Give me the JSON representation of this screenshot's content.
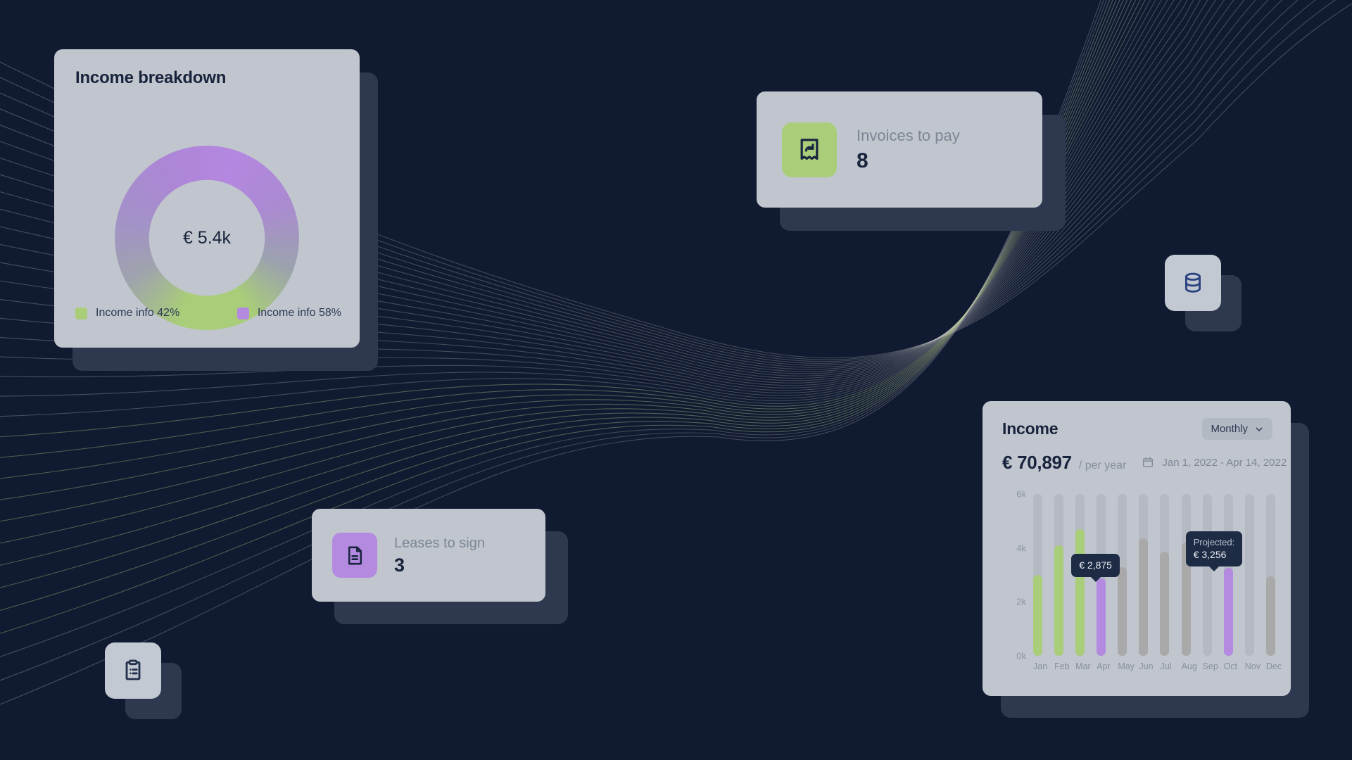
{
  "theme": {
    "background": "#101a31",
    "card_bg": "#c1c6ce",
    "shadow_card": "#2e3950",
    "green": "#a9cd78",
    "purple": "#b48ae0",
    "ink": "#18233c",
    "muted": "#7e8795",
    "tooltip_bg": "#1e2b45"
  },
  "income_breakdown": {
    "title": "Income breakdown",
    "center_value": "€ 5.4k",
    "legend": [
      {
        "label": "Income info 42%",
        "color": "#a9cd78"
      },
      {
        "label": "Income info 58%",
        "color": "#b48ae0"
      }
    ]
  },
  "invoices_card": {
    "icon": "invoice-forward-icon",
    "icon_bg": "#a9cd78",
    "label": "Invoices to pay",
    "value": "8"
  },
  "leases_card": {
    "icon": "document-lines-icon",
    "icon_bg": "#b48ae0",
    "label": "Leases to sign",
    "value": "3"
  },
  "tiles": [
    {
      "name": "database-icon",
      "color": "#2b4380"
    },
    {
      "name": "clipboard-list-icon",
      "color": "#22304c"
    }
  ],
  "income_chart": {
    "title": "Income",
    "period_label": "Monthly",
    "chevron": "chevron-down-icon",
    "amount": "€ 70,897",
    "amount_unit": "/ per year",
    "calendar_icon": "calendar-icon",
    "date_range": "Jan 1, 2022 - Apr 14, 2022"
  },
  "chart_data": {
    "type": "bar",
    "title": "Income",
    "xlabel": "",
    "ylabel": "",
    "ylim": [
      0,
      6000
    ],
    "ytick_labels": [
      "0k",
      "2k",
      "4k",
      "6k"
    ],
    "ytick_values": [
      0,
      2000,
      4000,
      6000
    ],
    "grid": false,
    "legend": false,
    "track_max": 6000,
    "categories": [
      "Jan",
      "Feb",
      "Mar",
      "Apr",
      "May",
      "Jun",
      "Jul",
      "Aug",
      "Sep",
      "Oct",
      "Nov",
      "Dec"
    ],
    "series": [
      {
        "name": "Income",
        "values": [
          3000,
          4100,
          4700,
          2875,
          3300,
          4350,
          3850,
          4200,
          0,
          3256,
          0,
          2950
        ],
        "colors": [
          "#a9cd78",
          "#a9cd78",
          "#a9cd78",
          "#b48ae0",
          "#a9a9a9",
          "#a9a9a9",
          "#a9a9a9",
          "#a9a9a9",
          "none",
          "#b48ae0",
          "none",
          "#a9a9a9"
        ]
      }
    ],
    "annotations": [
      {
        "category": "Apr",
        "caption": "",
        "value_text": "€ 2,875"
      },
      {
        "category": "Oct",
        "caption": "Projected:",
        "value_text": "€ 3,256"
      }
    ]
  }
}
